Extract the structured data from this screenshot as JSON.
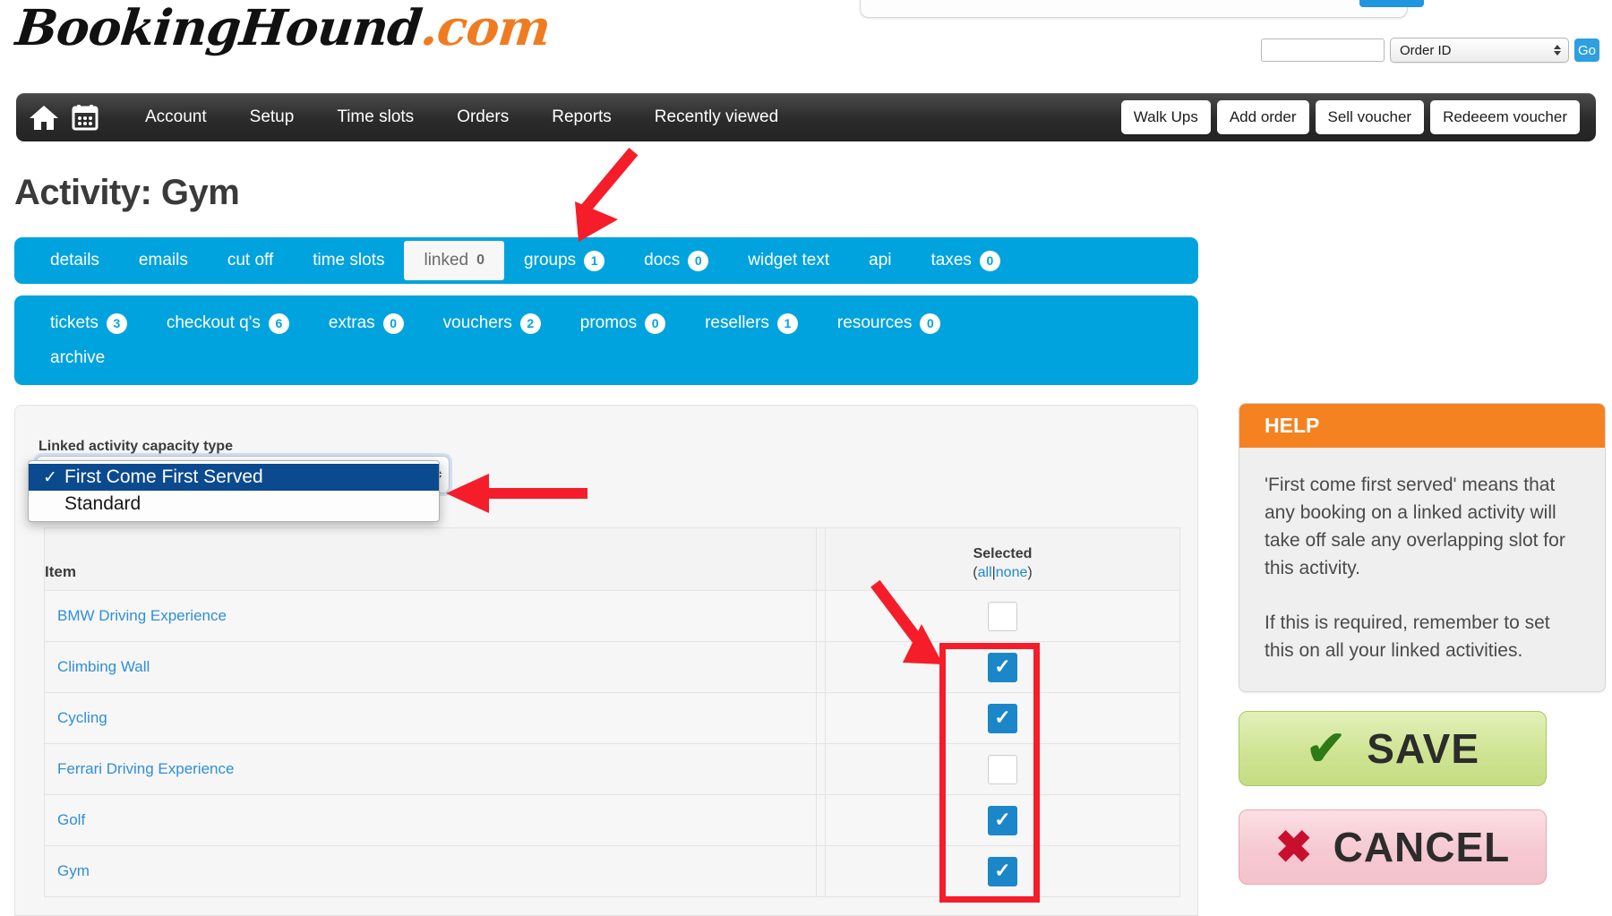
{
  "brand": {
    "name": "BookingHound",
    "suffix": ".com"
  },
  "top_search": {
    "input_value": "",
    "input_placeholder": "",
    "select_value": "Order ID",
    "go_label": "Go"
  },
  "mainnav": {
    "home_icon": "home-icon",
    "calendar_icon": "calendar-icon",
    "links": [
      {
        "label": "Account"
      },
      {
        "label": "Setup"
      },
      {
        "label": "Time slots"
      },
      {
        "label": "Orders"
      },
      {
        "label": "Reports"
      },
      {
        "label": "Recently viewed"
      }
    ],
    "buttons": [
      {
        "label": "Walk Ups"
      },
      {
        "label": "Add order"
      },
      {
        "label": "Sell voucher"
      },
      {
        "label": "Redeeem voucher"
      }
    ]
  },
  "page": {
    "title": "Activity: Gym"
  },
  "tabs_row1": [
    {
      "label": "details",
      "badge": null,
      "active": false
    },
    {
      "label": "emails",
      "badge": null,
      "active": false
    },
    {
      "label": "cut off",
      "badge": null,
      "active": false
    },
    {
      "label": "time slots",
      "badge": null,
      "active": false
    },
    {
      "label": "linked",
      "badge": "0",
      "active": true
    },
    {
      "label": "groups",
      "badge": "1",
      "active": false
    },
    {
      "label": "docs",
      "badge": "0",
      "active": false
    },
    {
      "label": "widget text",
      "badge": null,
      "active": false
    },
    {
      "label": "api",
      "badge": null,
      "active": false
    },
    {
      "label": "taxes",
      "badge": "0",
      "active": false
    }
  ],
  "tabs_row2": [
    {
      "label": "tickets",
      "badge": "3"
    },
    {
      "label": "checkout q's",
      "badge": "6"
    },
    {
      "label": "extras",
      "badge": "0"
    },
    {
      "label": "vouchers",
      "badge": "2"
    },
    {
      "label": "promos",
      "badge": "0"
    },
    {
      "label": "resellers",
      "badge": "1"
    },
    {
      "label": "resources",
      "badge": "0"
    },
    {
      "label": "archive",
      "badge": null
    }
  ],
  "form": {
    "capacity_label": "Linked activity capacity type",
    "capacity_selected": "First Come First Served",
    "capacity_options": [
      {
        "label": "First Come First Served",
        "selected": true
      },
      {
        "label": "Standard",
        "selected": false
      }
    ]
  },
  "table": {
    "header_item": "Item",
    "header_selected": "Selected",
    "header_all": "all",
    "header_sep": "|",
    "header_none": "none",
    "rows": [
      {
        "item": "BMW Driving Experience",
        "checked": false
      },
      {
        "item": "Climbing Wall",
        "checked": true
      },
      {
        "item": "Cycling",
        "checked": true
      },
      {
        "item": "Ferrari Driving Experience",
        "checked": false
      },
      {
        "item": "Golf",
        "checked": true
      },
      {
        "item": "Gym",
        "checked": true
      }
    ]
  },
  "help": {
    "title": "HELP",
    "paragraph1": "'First come first served' means that any booking on a linked activity will take off sale any overlapping slot for this activity.",
    "paragraph2": "If this is required, remember to set this on all your linked activities."
  },
  "actions": {
    "save_label": "SAVE",
    "cancel_label": "CANCEL",
    "save_icon": "check-icon",
    "cancel_icon": "cross-icon"
  },
  "colors": {
    "tab_blue": "#00a3dd",
    "link_blue": "#2f8fd6",
    "checkbox_blue": "#1b87c9",
    "help_orange": "#f58220",
    "annotation_red": "#f51d2a",
    "select_highlight": "#0b4a8f",
    "brand_orange": "#ef7c22"
  }
}
